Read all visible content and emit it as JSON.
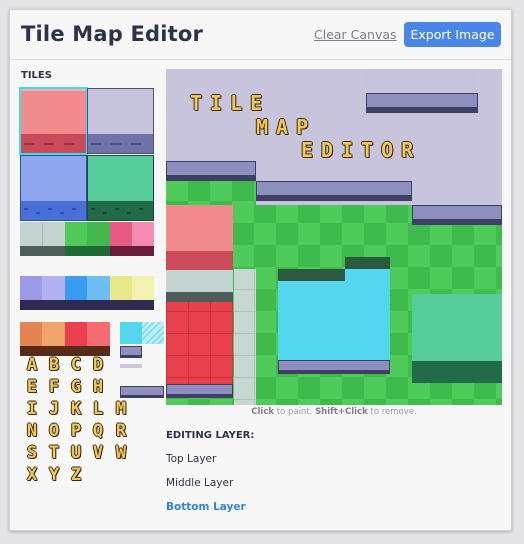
{
  "app": {
    "title": "Tile Map Editor",
    "clear_label": "Clear Canvas",
    "export_label": "Export Image"
  },
  "palette": {
    "heading": "TILES",
    "letters": [
      "A",
      "B",
      "C",
      "D",
      "E",
      "F",
      "G",
      "H",
      "I",
      "J",
      "K",
      "L",
      "M",
      "N",
      "O",
      "P",
      "Q",
      "R",
      "S",
      "T",
      "U",
      "V",
      "W",
      "X",
      "Y",
      "Z"
    ]
  },
  "canvas": {
    "title_words": [
      "TILE",
      "MAP",
      "EDITOR"
    ]
  },
  "hint": {
    "click": "Click",
    "click_text": " to paint. ",
    "shift": "Shift+Click",
    "shift_text": " to remove."
  },
  "layers": {
    "heading": "EDITING LAYER:",
    "items": [
      "Top Layer",
      "Middle Layer",
      "Bottom Layer"
    ],
    "active": "Bottom Layer"
  },
  "colors": {
    "accent": "#4a86e8",
    "active_layer": "#2f84d8",
    "selection": "#35e2e6"
  }
}
